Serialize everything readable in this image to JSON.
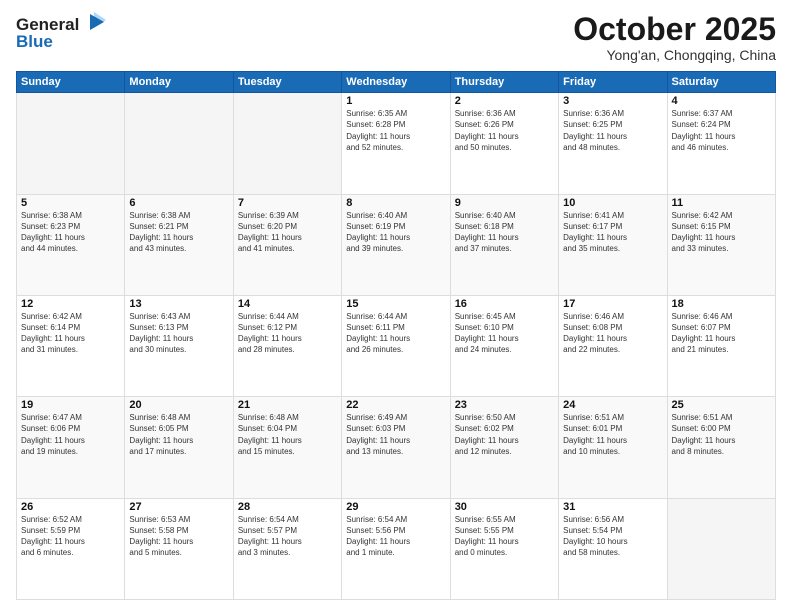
{
  "header": {
    "logo_general": "General",
    "logo_blue": "Blue",
    "month": "October 2025",
    "location": "Yong'an, Chongqing, China"
  },
  "weekdays": [
    "Sunday",
    "Monday",
    "Tuesday",
    "Wednesday",
    "Thursday",
    "Friday",
    "Saturday"
  ],
  "weeks": [
    [
      {
        "day": "",
        "info": ""
      },
      {
        "day": "",
        "info": ""
      },
      {
        "day": "",
        "info": ""
      },
      {
        "day": "1",
        "info": "Sunrise: 6:35 AM\nSunset: 6:28 PM\nDaylight: 11 hours\nand 52 minutes."
      },
      {
        "day": "2",
        "info": "Sunrise: 6:36 AM\nSunset: 6:26 PM\nDaylight: 11 hours\nand 50 minutes."
      },
      {
        "day": "3",
        "info": "Sunrise: 6:36 AM\nSunset: 6:25 PM\nDaylight: 11 hours\nand 48 minutes."
      },
      {
        "day": "4",
        "info": "Sunrise: 6:37 AM\nSunset: 6:24 PM\nDaylight: 11 hours\nand 46 minutes."
      }
    ],
    [
      {
        "day": "5",
        "info": "Sunrise: 6:38 AM\nSunset: 6:23 PM\nDaylight: 11 hours\nand 44 minutes."
      },
      {
        "day": "6",
        "info": "Sunrise: 6:38 AM\nSunset: 6:21 PM\nDaylight: 11 hours\nand 43 minutes."
      },
      {
        "day": "7",
        "info": "Sunrise: 6:39 AM\nSunset: 6:20 PM\nDaylight: 11 hours\nand 41 minutes."
      },
      {
        "day": "8",
        "info": "Sunrise: 6:40 AM\nSunset: 6:19 PM\nDaylight: 11 hours\nand 39 minutes."
      },
      {
        "day": "9",
        "info": "Sunrise: 6:40 AM\nSunset: 6:18 PM\nDaylight: 11 hours\nand 37 minutes."
      },
      {
        "day": "10",
        "info": "Sunrise: 6:41 AM\nSunset: 6:17 PM\nDaylight: 11 hours\nand 35 minutes."
      },
      {
        "day": "11",
        "info": "Sunrise: 6:42 AM\nSunset: 6:15 PM\nDaylight: 11 hours\nand 33 minutes."
      }
    ],
    [
      {
        "day": "12",
        "info": "Sunrise: 6:42 AM\nSunset: 6:14 PM\nDaylight: 11 hours\nand 31 minutes."
      },
      {
        "day": "13",
        "info": "Sunrise: 6:43 AM\nSunset: 6:13 PM\nDaylight: 11 hours\nand 30 minutes."
      },
      {
        "day": "14",
        "info": "Sunrise: 6:44 AM\nSunset: 6:12 PM\nDaylight: 11 hours\nand 28 minutes."
      },
      {
        "day": "15",
        "info": "Sunrise: 6:44 AM\nSunset: 6:11 PM\nDaylight: 11 hours\nand 26 minutes."
      },
      {
        "day": "16",
        "info": "Sunrise: 6:45 AM\nSunset: 6:10 PM\nDaylight: 11 hours\nand 24 minutes."
      },
      {
        "day": "17",
        "info": "Sunrise: 6:46 AM\nSunset: 6:08 PM\nDaylight: 11 hours\nand 22 minutes."
      },
      {
        "day": "18",
        "info": "Sunrise: 6:46 AM\nSunset: 6:07 PM\nDaylight: 11 hours\nand 21 minutes."
      }
    ],
    [
      {
        "day": "19",
        "info": "Sunrise: 6:47 AM\nSunset: 6:06 PM\nDaylight: 11 hours\nand 19 minutes."
      },
      {
        "day": "20",
        "info": "Sunrise: 6:48 AM\nSunset: 6:05 PM\nDaylight: 11 hours\nand 17 minutes."
      },
      {
        "day": "21",
        "info": "Sunrise: 6:48 AM\nSunset: 6:04 PM\nDaylight: 11 hours\nand 15 minutes."
      },
      {
        "day": "22",
        "info": "Sunrise: 6:49 AM\nSunset: 6:03 PM\nDaylight: 11 hours\nand 13 minutes."
      },
      {
        "day": "23",
        "info": "Sunrise: 6:50 AM\nSunset: 6:02 PM\nDaylight: 11 hours\nand 12 minutes."
      },
      {
        "day": "24",
        "info": "Sunrise: 6:51 AM\nSunset: 6:01 PM\nDaylight: 11 hours\nand 10 minutes."
      },
      {
        "day": "25",
        "info": "Sunrise: 6:51 AM\nSunset: 6:00 PM\nDaylight: 11 hours\nand 8 minutes."
      }
    ],
    [
      {
        "day": "26",
        "info": "Sunrise: 6:52 AM\nSunset: 5:59 PM\nDaylight: 11 hours\nand 6 minutes."
      },
      {
        "day": "27",
        "info": "Sunrise: 6:53 AM\nSunset: 5:58 PM\nDaylight: 11 hours\nand 5 minutes."
      },
      {
        "day": "28",
        "info": "Sunrise: 6:54 AM\nSunset: 5:57 PM\nDaylight: 11 hours\nand 3 minutes."
      },
      {
        "day": "29",
        "info": "Sunrise: 6:54 AM\nSunset: 5:56 PM\nDaylight: 11 hours\nand 1 minute."
      },
      {
        "day": "30",
        "info": "Sunrise: 6:55 AM\nSunset: 5:55 PM\nDaylight: 11 hours\nand 0 minutes."
      },
      {
        "day": "31",
        "info": "Sunrise: 6:56 AM\nSunset: 5:54 PM\nDaylight: 10 hours\nand 58 minutes."
      },
      {
        "day": "",
        "info": ""
      }
    ]
  ]
}
